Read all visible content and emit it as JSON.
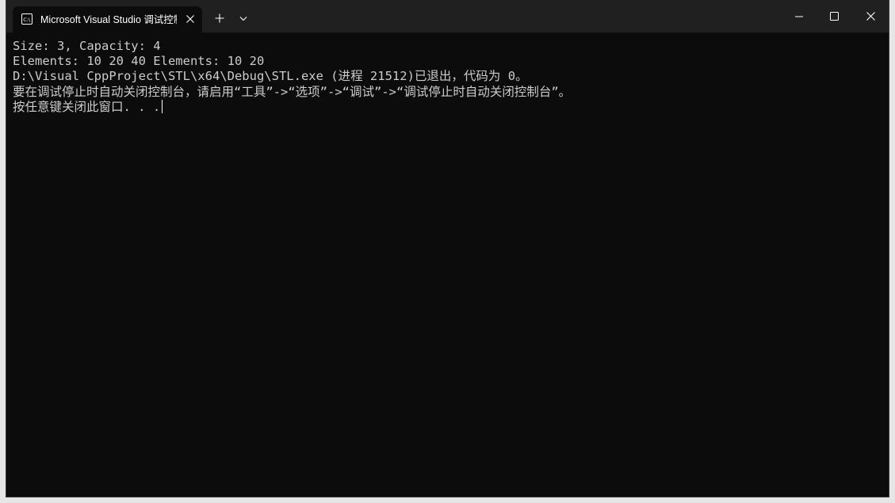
{
  "tab": {
    "title": "Microsoft Visual Studio 调试控制台",
    "icon": "terminal-app-icon",
    "close_icon": "close-icon"
  },
  "titlebar": {
    "new_tab_icon": "plus-icon",
    "dropdown_icon": "chevron-down-icon",
    "minimize_icon": "minimize-icon",
    "maximize_icon": "maximize-icon",
    "close_icon": "close-icon"
  },
  "colors": {
    "terminal_background": "#0c0c0c",
    "terminal_text": "#cccccc",
    "titlebar_background": "#202020"
  },
  "console": {
    "lines": [
      "Size: 3, Capacity: 4",
      "Elements: 10 20 40 Elements: 10 20",
      "D:\\Visual CppProject\\STL\\x64\\Debug\\STL.exe (进程 21512)已退出，代码为 0。",
      "要在调试停止时自动关闭控制台，请启用“工具”->“选项”->“调试”->“调试停止时自动关闭控制台”。",
      "按任意键关闭此窗口. . ."
    ]
  }
}
